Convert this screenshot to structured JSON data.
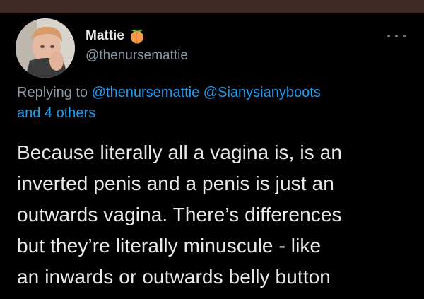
{
  "colors": {
    "background": "#000000",
    "top_strip": "#3f2a27",
    "primary_text": "#e7e9ea",
    "secondary_text": "#8b98a5",
    "link": "#1d9bf0"
  },
  "author": {
    "display_name": "Mattie",
    "badge_icon": "peach-emoji-icon",
    "handle": "@thenursemattie"
  },
  "more_menu": {
    "icon": "more-horizontal-icon"
  },
  "reply_context": {
    "prefix": "Replying to",
    "mention_1": "@thenursemattie",
    "mention_2": "@Sianysianyboots",
    "others": "and 4 others"
  },
  "tweet": {
    "text": "Because literally all a vagina is, is an\ninverted penis and a penis is just an\noutwards vagina. There’s differences\nbut they’re literally minuscule - like\nan inwards or outwards belly button"
  }
}
